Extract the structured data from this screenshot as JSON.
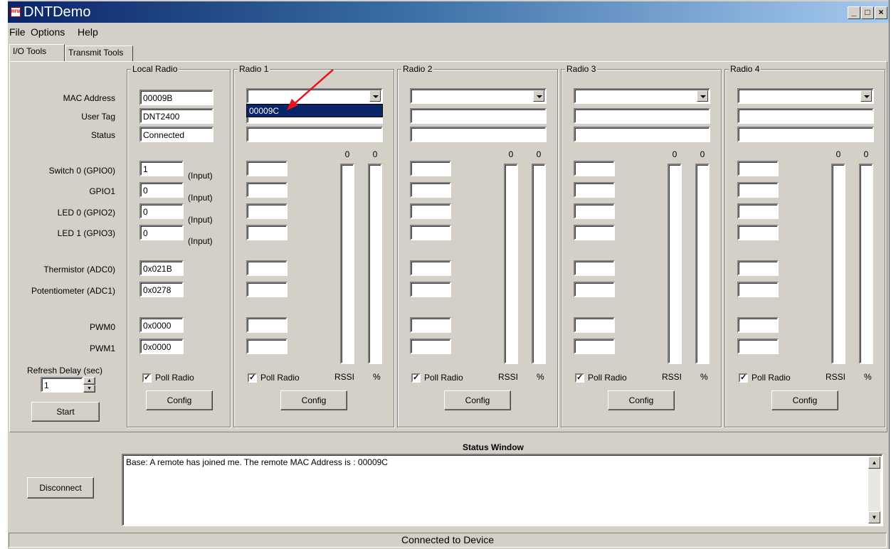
{
  "window": {
    "title": "DNTDemo",
    "icon_text": "RFM"
  },
  "menu": [
    {
      "label": "File",
      "underline": "F"
    },
    {
      "label": "Options",
      "underline": "O"
    },
    {
      "label": "Help",
      "underline": "H"
    }
  ],
  "tabs": [
    {
      "label": "I/O Tools",
      "selected": true
    },
    {
      "label": "Transmit Tools",
      "selected": false
    }
  ],
  "row_labels": {
    "mac": "MAC Address",
    "user_tag": "User Tag",
    "status": "Status",
    "switch0": "Switch 0 (GPIO0)",
    "gpio1": "GPIO1",
    "led0": "LED 0 (GPIO2)",
    "led1": "LED 1 (GPIO3)",
    "thermistor": "Thermistor (ADC0)",
    "potentiometer": "Potentiometer (ADC1)",
    "pwm0": "PWM0",
    "pwm1": "PWM1",
    "refresh_delay": "Refresh Delay (sec)"
  },
  "refresh_delay_value": "1",
  "start_label": "Start",
  "local_radio": {
    "title": "Local Radio",
    "mac": "00009B",
    "user_tag": "DNT2400",
    "status": "Connected",
    "switch0": "1",
    "gpio1": "0",
    "led0": "0",
    "led1": "0",
    "io_tag": "(Input)",
    "thermistor": "0x021B",
    "potentiometer": "0x0278",
    "pwm0": "0x0000",
    "pwm1": "0x0000",
    "poll_label": "Poll Radio",
    "poll_checked": true,
    "config_label": "Config"
  },
  "radios": [
    {
      "title": "Radio 1",
      "rssi_value": "0",
      "pct_value": "0",
      "rssi_label": "RSSI",
      "pct_label": "%",
      "poll_label": "Poll Radio",
      "config_label": "Config"
    },
    {
      "title": "Radio 2",
      "rssi_value": "0",
      "pct_value": "0",
      "rssi_label": "RSSI",
      "pct_label": "%",
      "poll_label": "Poll Radio",
      "config_label": "Config"
    },
    {
      "title": "Radio 3",
      "rssi_value": "0",
      "pct_value": "0",
      "rssi_label": "RSSI",
      "pct_label": "%",
      "poll_label": "Poll Radio",
      "config_label": "Config"
    },
    {
      "title": "Radio 4",
      "rssi_value": "0",
      "pct_value": "0",
      "rssi_label": "RSSI",
      "pct_label": "%",
      "poll_label": "Poll Radio",
      "config_label": "Config"
    }
  ],
  "dropdown_option": "00009C",
  "status_window": {
    "title": "Status Window",
    "text": "Base:  A remote has joined me.  The remote MAC Address is : 00009C"
  },
  "disconnect_label": "Disconnect",
  "statusbar": "Connected to Device",
  "colors": {
    "titlebar": "#0a246a",
    "face": "#d4d0c8",
    "highlight": "#0a246a",
    "annotation_arrow": "#e8141b"
  }
}
